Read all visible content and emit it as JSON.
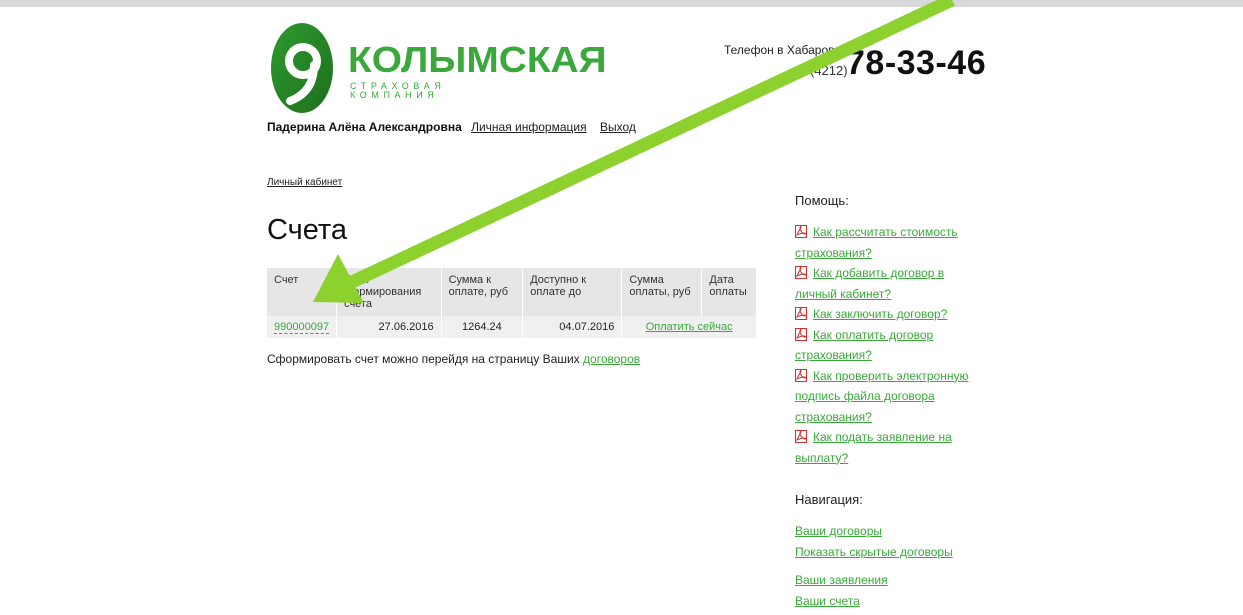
{
  "header": {
    "logo_title": "КОЛЫМСКАЯ",
    "logo_subtitle": "СТРАХОВАЯ КОМПАНИЯ",
    "phone_label": "Телефон в Хабаровске",
    "phone_code": "(4212)",
    "phone_number": "78-33-46"
  },
  "user": {
    "name": "Падерина Алёна Александровна",
    "personal_info_link": "Личная информация",
    "logout_link": "Выход"
  },
  "breadcrumb": "Личный кабинет",
  "page_title": "Счета",
  "invoices_table": {
    "headers": [
      "Счет",
      "Дата формирования счета",
      "Сумма к оплате, руб",
      "Доступно к оплате до",
      "Сумма оплаты, руб",
      "Дата оплаты"
    ],
    "rows": [
      {
        "invoice": "990000097",
        "created": "27.06.2016",
        "amount": "1264.24",
        "available_until": "04.07.2016",
        "pay_link": "Оплатить сейчас"
      }
    ]
  },
  "note": {
    "text": "Сформировать счет можно перейдя на страницу Ваших",
    "link": "договоров"
  },
  "help": {
    "title": "Помощь:",
    "items": [
      "Как рассчитать стоимость страхования?",
      "Как добавить договор в личный кабинет?",
      "Как заключить договор?",
      "Как оплатить договор страхования?",
      "Как проверить электронную подпись файла договора страхования?",
      "Как подать заявление на выплату?"
    ]
  },
  "navigation": {
    "title": "Навигация:",
    "group1": [
      "Ваши договоры",
      "Показать скрытые договоры"
    ],
    "group2": [
      "Ваши заявления",
      "Ваши счета"
    ]
  },
  "colors": {
    "brand_green": "#3aa83a",
    "annotation_arrow": "#8dd12f"
  },
  "icons": {
    "help_item_icon": "pdf-icon"
  }
}
